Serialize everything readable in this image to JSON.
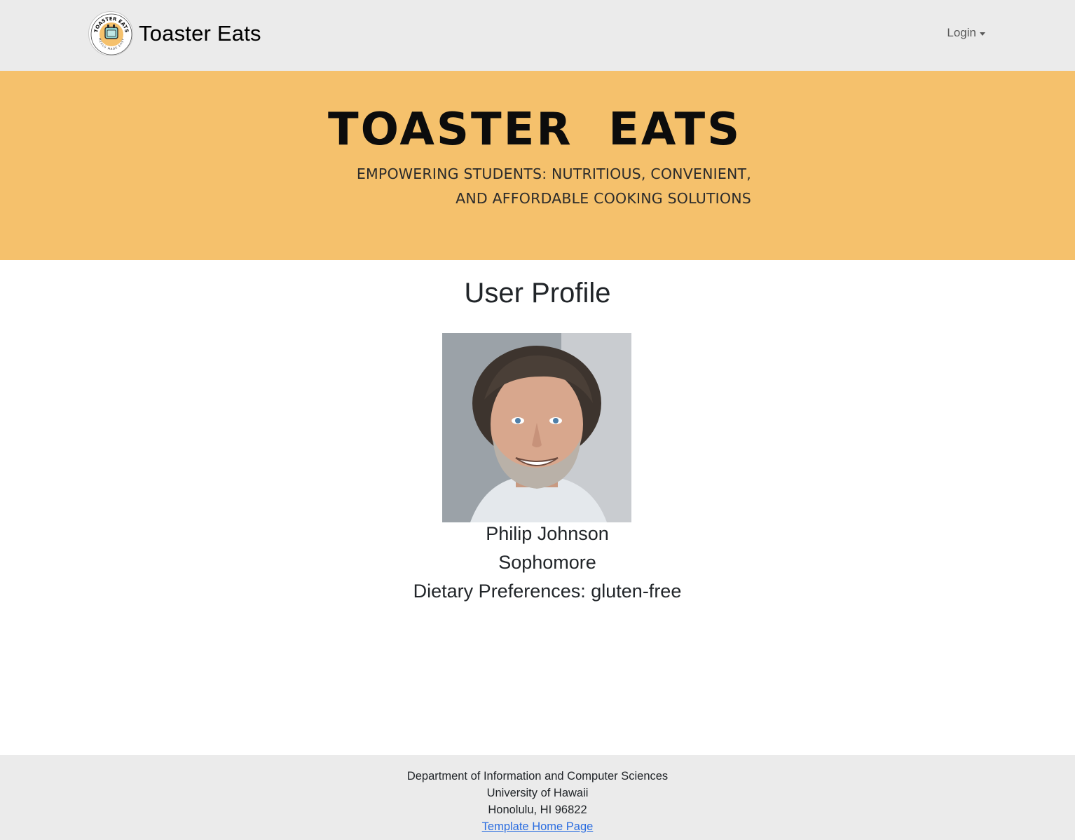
{
  "navbar": {
    "brand_name": "Toaster Eats",
    "logo_text": "TOASTER EATS",
    "logo_subtext": "MEALS MADE EASY",
    "login_label": "Login"
  },
  "banner": {
    "title": "TOASTER  EATS",
    "subtitle_line1": "EMPOWERING STUDENTS: NUTRITIOUS, CONVENIENT,",
    "subtitle_line2": "AND AFFORDABLE COOKING SOLUTIONS"
  },
  "profile": {
    "page_title": "User Profile",
    "name": "Philip Johnson",
    "year": "Sophomore",
    "dietary": "Dietary Preferences: gluten-free"
  },
  "footer": {
    "line1": "Department of Information and Computer Sciences",
    "line2": "University of Hawaii",
    "line3": "Honolulu, HI 96822",
    "link_label": "Template Home Page"
  },
  "colors": {
    "banner_bg": "#f5c16c",
    "navbar_bg": "#ebebeb",
    "link": "#2b6de0"
  }
}
